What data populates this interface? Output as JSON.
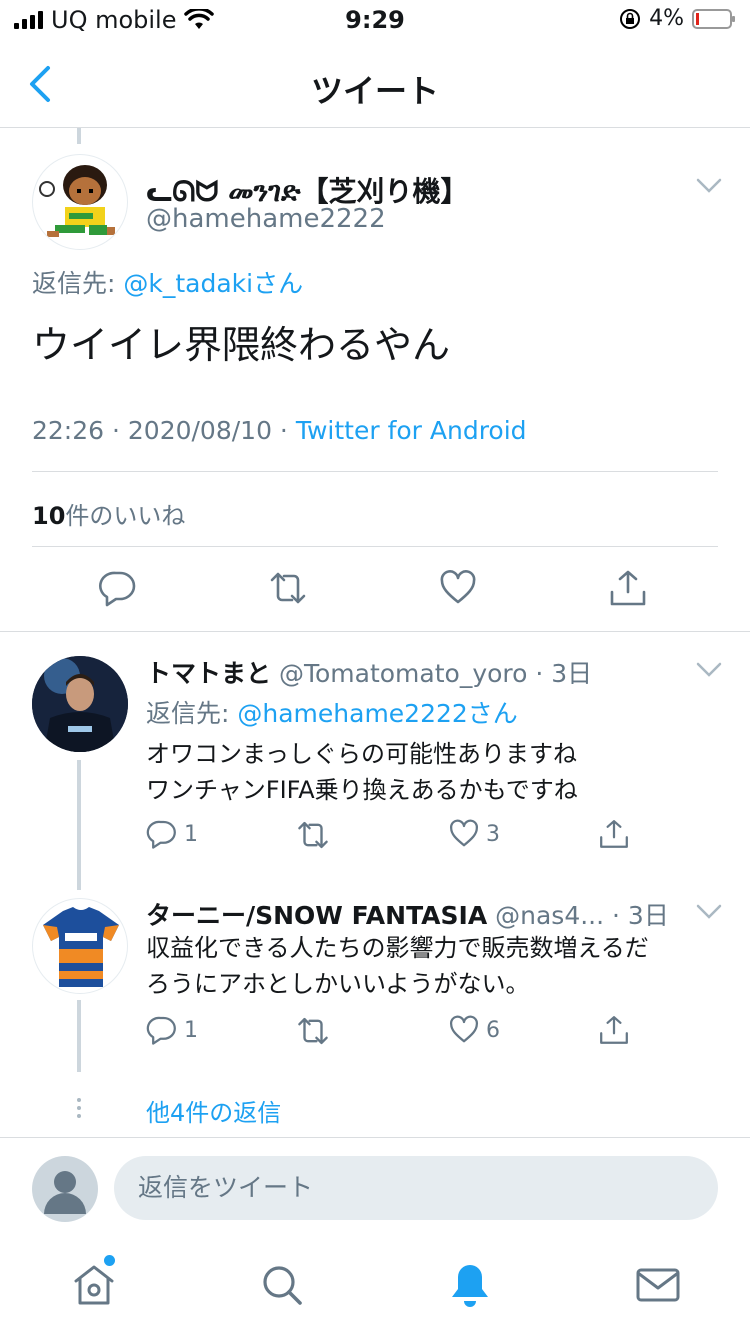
{
  "status_bar": {
    "carrier": "UQ mobile",
    "time": "9:29",
    "battery": "4%"
  },
  "nav": {
    "title": "ツイート"
  },
  "main_tweet": {
    "display_name": "ᓚᘏᗢ መንገድ【芝刈り機】",
    "handle": "@hamehame2222",
    "reply_to_label": "返信先: ",
    "reply_to_user": "@k_tadakiさん",
    "text": "ウイイレ界隈終わるやん",
    "timestamp": "22:26 · 2020/08/10 · ",
    "client": "Twitter for Android",
    "like_count": "10",
    "like_label": "件のいいね"
  },
  "replies": [
    {
      "name": "トマトまと",
      "handle": " @Tomatomato_yoro",
      "time": " · 3日",
      "reply_to_label": "返信先: ",
      "reply_to_user": "@hamehame2222さん",
      "text_lines": [
        "オワコンまっしぐらの可能性ありますね",
        "ワンチャンFIFA乗り換えあるかもですね"
      ],
      "reply_count": "1",
      "like_count": "3"
    },
    {
      "name": "ターニー/SNOW FANTASIA",
      "handle": " @nas4...",
      "time": " · 3日",
      "text_lines": [
        "収益化できる人たちの影響力で販売数増えるだ",
        "ろうにアホとしかいいようがない。"
      ],
      "reply_count": "1",
      "like_count": "6"
    }
  ],
  "more_replies": "他4件の返信",
  "compose": {
    "placeholder": "返信をツイート"
  },
  "colors": {
    "accent": "#1da1f2",
    "secondary_text": "#657786",
    "divider": "#dadde0"
  },
  "icons": [
    "back-chevron-icon",
    "more-chevron-icon",
    "reply-icon",
    "retweet-icon",
    "like-icon",
    "share-icon",
    "home-icon",
    "search-icon",
    "notifications-icon",
    "messages-icon"
  ]
}
